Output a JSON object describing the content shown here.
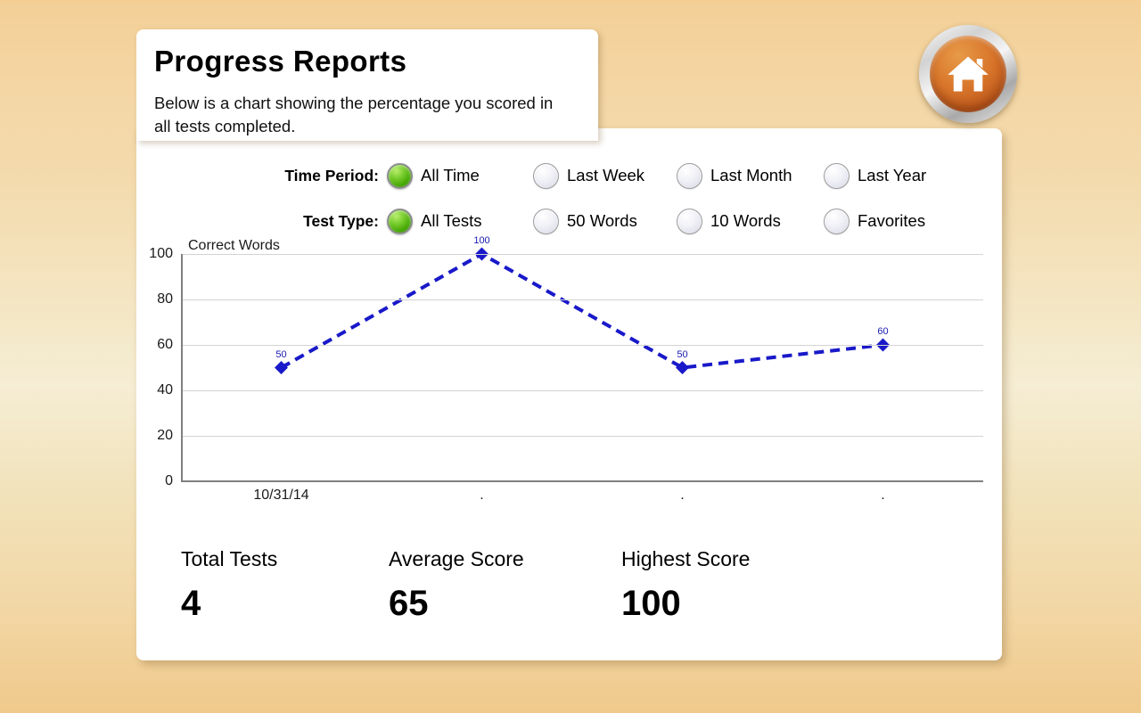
{
  "header": {
    "title": "Progress  Reports",
    "subtitle": "Below is a chart showing the percentage you scored in all tests completed.",
    "home_button_icon": "home-icon"
  },
  "filters": [
    {
      "label": "Time Period:",
      "options": [
        {
          "label": "All Time",
          "selected": true
        },
        {
          "label": "Last Week",
          "selected": false
        },
        {
          "label": "Last Month",
          "selected": false
        },
        {
          "label": "Last Year",
          "selected": false
        }
      ]
    },
    {
      "label": "Test Type:",
      "options": [
        {
          "label": "All Tests",
          "selected": true
        },
        {
          "label": "50 Words",
          "selected": false
        },
        {
          "label": "10 Words",
          "selected": false
        },
        {
          "label": "Favorites",
          "selected": false
        }
      ]
    }
  ],
  "chart_data": {
    "type": "line",
    "title": "Correct Words",
    "xlabel": "",
    "ylabel": "",
    "categories": [
      "10/31/14",
      ".",
      ".",
      "."
    ],
    "values": [
      50,
      100,
      50,
      60
    ],
    "point_labels": [
      "50",
      "100",
      "50",
      "60"
    ],
    "ylim": [
      0,
      100
    ],
    "yticks": [
      0,
      20,
      40,
      60,
      80,
      100
    ],
    "ytick_labels": [
      "0",
      "20",
      "40",
      "60",
      "80",
      "100"
    ],
    "grid": true,
    "legend": false,
    "series_color": "#1919c9",
    "line_style": "dashed",
    "marker": "diamond"
  },
  "stats": [
    {
      "label": "Total Tests",
      "value": "4"
    },
    {
      "label": "Average Score",
      "value": "65"
    },
    {
      "label": "Highest Score",
      "value": "100"
    }
  ],
  "colors": {
    "background_top": "#f3cf96",
    "background_mid": "#f5edd4",
    "card": "#ffffff",
    "accent_orange": "#d8752a",
    "radio_selected_green": "#46a805",
    "chart_blue": "#1919c9",
    "gridline": "#d3d3d3",
    "axis": "#808080"
  }
}
